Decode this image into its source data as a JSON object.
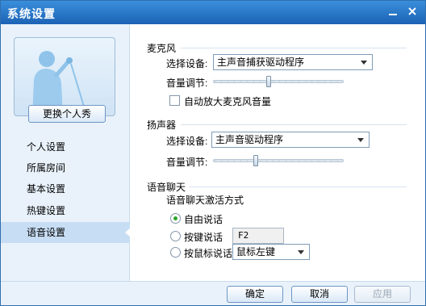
{
  "window": {
    "title": "系统设置"
  },
  "sidebar": {
    "change_avatar_label": "更换个人秀",
    "items": [
      {
        "label": "个人设置"
      },
      {
        "label": "所属房间"
      },
      {
        "label": "基本设置"
      },
      {
        "label": "热键设置"
      },
      {
        "label": "语音设置"
      }
    ],
    "active_item": "语音设置"
  },
  "microphone": {
    "title": "麦克风",
    "device_label": "选择设备:",
    "device_value": "主声音捕获驱动程序",
    "volume_label": "音量调节:",
    "volume_level": 0.42,
    "auto_amplify_label": "自动放大麦克风音量",
    "auto_amplify_checked": false
  },
  "speaker": {
    "title": "扬声器",
    "device_label": "选择设备:",
    "device_value": "主声音驱动程序",
    "volume_label": "音量调节:",
    "volume_level": 0.32
  },
  "voice_chat": {
    "title": "语音聊天",
    "activation_label": "语音聊天激活方式",
    "options": [
      {
        "label": "自由说话",
        "checked": true
      },
      {
        "label": "按键说话",
        "checked": false
      },
      {
        "label": "按鼠标说话",
        "checked": false
      }
    ],
    "hotkey_value": "F2",
    "mouse_button_value": "鼠标左键"
  },
  "footer": {
    "ok_label": "确定",
    "cancel_label": "取消",
    "apply_label": "应用"
  },
  "colors": {
    "titlebar": "#1b62b5",
    "sidebar": "#e9f2fb",
    "radio_checked": "#2aa42a"
  }
}
